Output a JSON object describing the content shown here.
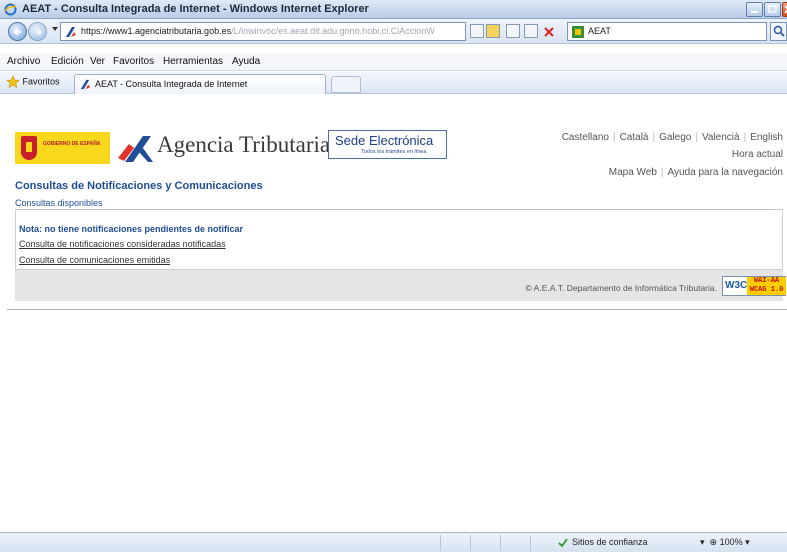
{
  "window": {
    "title": "AEAT - Consulta Integrada de Internet - Windows Internet Explorer"
  },
  "address": {
    "url_bold": "https://www1.agenciatributaria.gob.es",
    "url_rest": "/L/inwinvoc/es.aeat.dit.adu.gnno.hobi.ci.CiAccionW",
    "search_value": "AEAT"
  },
  "menu": {
    "items": [
      "Archivo",
      "Edición",
      "Ver",
      "Favoritos",
      "Herramientas",
      "Ayuda"
    ]
  },
  "favorites": {
    "label": "Favoritos",
    "tab_label": "AEAT - Consulta Integrada de Internet"
  },
  "header": {
    "gobierno": "GOBIERNO DE ESPAÑA",
    "agencia": "Agencia Tributaria",
    "sede_title": "Sede Electrónica",
    "sede_sub": "Todos los trámites en línea",
    "languages": [
      "Castellano",
      "Català",
      "Galego",
      "Valencià",
      "English"
    ],
    "hora": "Hora actual",
    "mapa_web": "Mapa Web",
    "ayuda": "Ayuda para la navegación"
  },
  "content": {
    "page_title": "Consultas de Notificaciones y Comunicaciones",
    "subnav": "Consultas disponibles",
    "nota": "Nota: no tiene notificaciones pendientes de notificar",
    "link1": "Consulta de notificaciones consideradas notificadas",
    "link2": "Consulta de comunicaciones emitidas",
    "copyright": "© A.E.A.T. Departamento de Informática Tributaria.",
    "w3c": "W3C",
    "wai": "WAI-AA WCAG 1.0"
  },
  "status": {
    "zone": "Sitios de confianza",
    "zoom": "100%"
  },
  "colors": {
    "link_blue": "#1f4e96",
    "gov_yellow": "#f7d81d",
    "gov_red": "#c8202a"
  }
}
